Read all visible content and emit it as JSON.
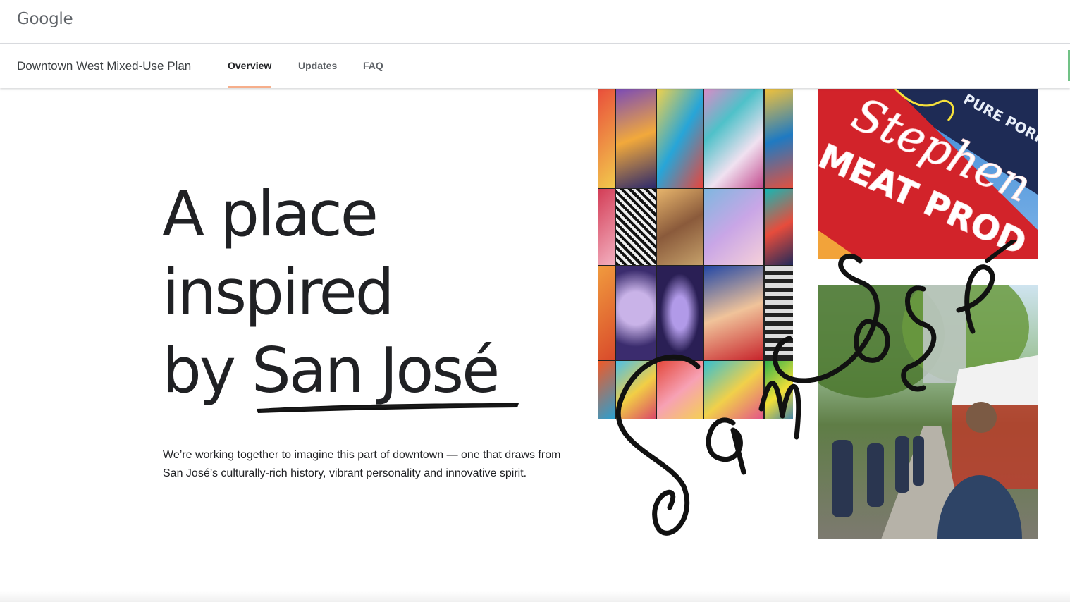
{
  "header": {
    "logo": "Google"
  },
  "subnav": {
    "project_title": "Downtown West Mixed-Use Plan",
    "tabs": [
      {
        "label": "Overview",
        "active": true
      },
      {
        "label": "Updates",
        "active": false
      },
      {
        "label": "FAQ",
        "active": false
      }
    ],
    "active_underline_color": "#f6ae8b"
  },
  "hero": {
    "heading_lines": [
      "A place",
      "inspired",
      "by San José"
    ],
    "description": "We’re working together to imagine this part of downtown — one that draws from San José’s culturally-rich history, vibrant personality and innovative spirit."
  },
  "images": {
    "sign": {
      "text_line_1": "Stephen",
      "text_line_2": "MEAT PROD",
      "side_text": "PURE PORK SAUSAGE"
    }
  },
  "colors": {
    "text": "#202124",
    "secondary_text": "#5f6368",
    "sign_red": "#d2232a"
  }
}
